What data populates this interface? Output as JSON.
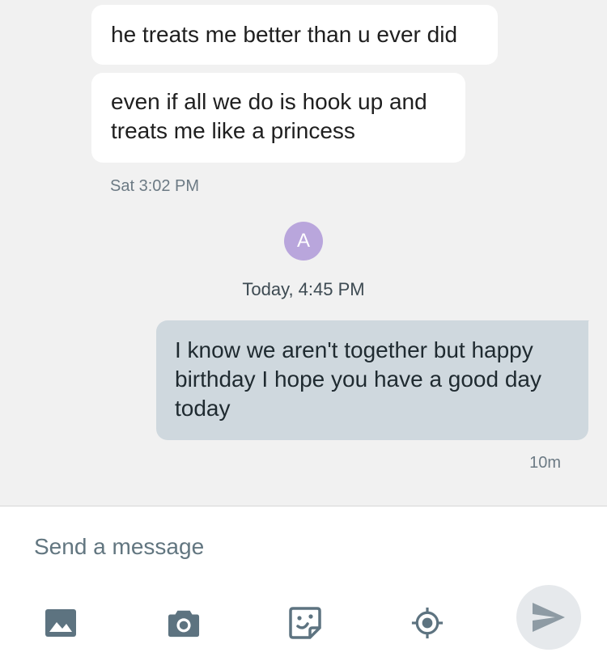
{
  "messages": [
    {
      "direction": "incoming",
      "text": "he treats me better than u ever did"
    },
    {
      "direction": "incoming",
      "text": "even if all we do is hook up and treats me like a princess"
    },
    {
      "direction": "outgoing",
      "text": "I know we aren't together but happy birthday I hope you have a good day today"
    }
  ],
  "incoming_timestamp": "Sat 3:02 PM",
  "contact": {
    "avatar_initial": "A",
    "avatar_color": "#b9a6dc"
  },
  "day_separator": "Today, 4:45 PM",
  "outgoing_timestamp": "10m",
  "composer": {
    "placeholder": "Send a message",
    "tools": [
      "image-icon",
      "camera-icon",
      "sticker-icon",
      "location-target-icon"
    ],
    "send_icon": "send-icon"
  },
  "colors": {
    "background": "#f1f1f1",
    "incoming_bubble": "#ffffff",
    "outgoing_bubble": "#cfd8de",
    "icon": "#5d7380"
  }
}
